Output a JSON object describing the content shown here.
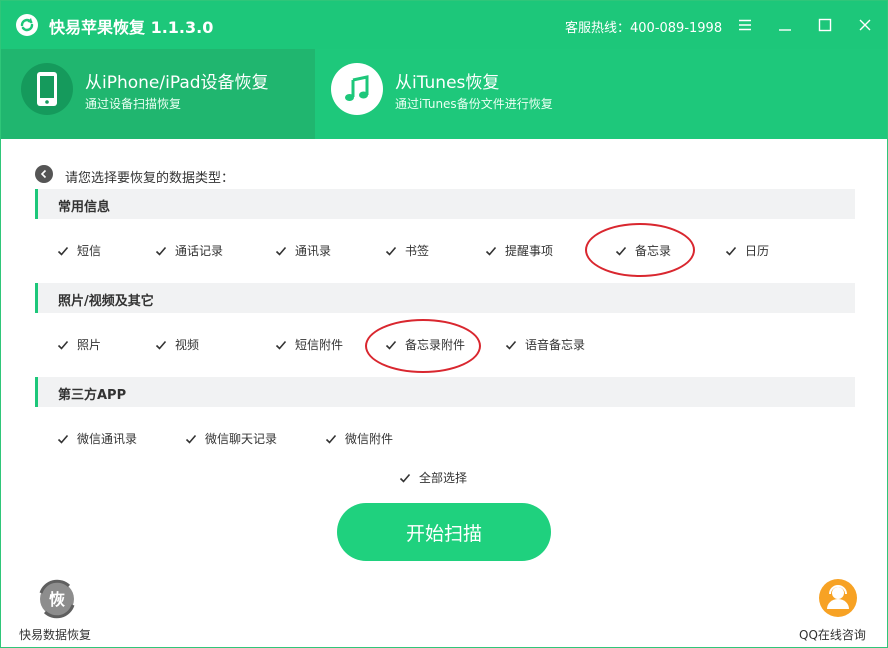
{
  "app": {
    "title": "快易苹果恢复 1.1.3.0",
    "hotline": "客服热线：400-089-1998",
    "accent_color": "#1dc77a",
    "highlight_color": "#d9272f"
  },
  "window_controls": [
    "menu-icon",
    "minimize-icon",
    "maximize-icon",
    "close-icon"
  ],
  "tabs": [
    {
      "title": "从iPhone/iPad设备恢复",
      "subtitle": "通过设备扫描恢复",
      "icon": "phone-icon",
      "active": true
    },
    {
      "title": "从iTunes恢复",
      "subtitle": "通过iTunes备份文件进行恢复",
      "icon": "music-note-icon",
      "active": false
    }
  ],
  "prompt": "请您选择要恢复的数据类型：",
  "sections": [
    {
      "title": "常用信息",
      "items": [
        {
          "label": "短信",
          "checked": true
        },
        {
          "label": "通话记录",
          "checked": true
        },
        {
          "label": "通讯录",
          "checked": true
        },
        {
          "label": "书签",
          "checked": true
        },
        {
          "label": "提醒事项",
          "checked": true
        },
        {
          "label": "备忘录",
          "checked": true,
          "highlighted": true
        },
        {
          "label": "日历",
          "checked": true
        }
      ]
    },
    {
      "title": "照片/视频及其它",
      "items": [
        {
          "label": "照片",
          "checked": true
        },
        {
          "label": "视频",
          "checked": true
        },
        {
          "label": "短信附件",
          "checked": true
        },
        {
          "label": "备忘录附件",
          "checked": true,
          "highlighted": true
        },
        {
          "label": "语音备忘录",
          "checked": true
        }
      ]
    },
    {
      "title": "第三方APP",
      "items": [
        {
          "label": "微信通讯录",
          "checked": true
        },
        {
          "label": "微信聊天记录",
          "checked": true
        },
        {
          "label": "微信附件",
          "checked": true
        }
      ]
    }
  ],
  "select_all": {
    "label": "全部选择",
    "checked": true
  },
  "scan_button": "开始扫描",
  "footer": {
    "left_logo_text": "恢",
    "left_label": "快易数据恢复",
    "right_label": "QQ在线咨询"
  }
}
